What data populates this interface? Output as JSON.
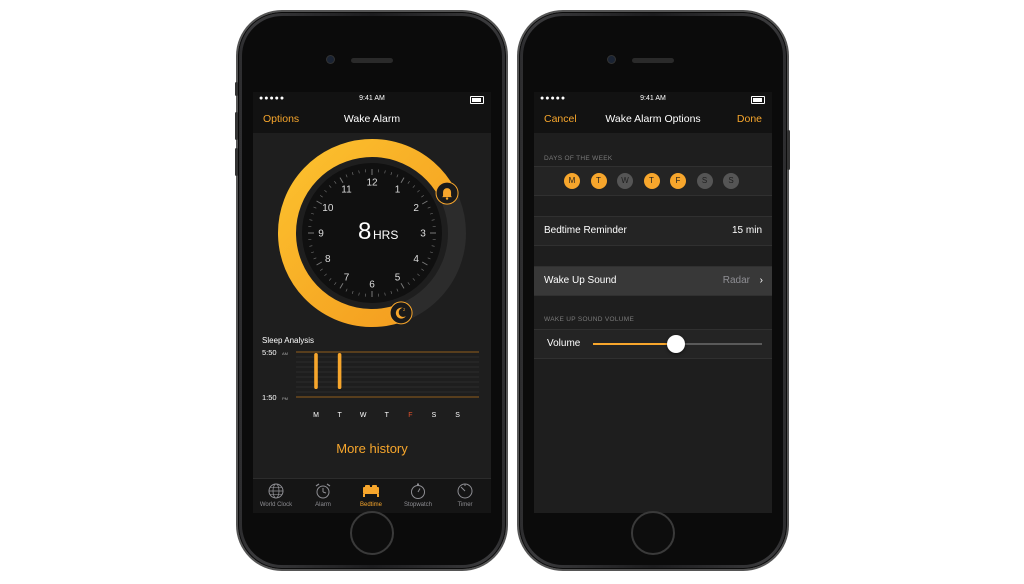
{
  "status": {
    "signal": "●●●●● ",
    "time": "9:41 AM"
  },
  "left_screen": {
    "nav": {
      "left": "Options",
      "title": "Wake Alarm"
    },
    "dial": {
      "hours_value": "8",
      "hours_unit": "HRS",
      "numbers": [
        "12",
        "1",
        "2",
        "3",
        "4",
        "5",
        "6",
        "7",
        "8",
        "9",
        "10",
        "11"
      ],
      "arc_color": "#f7a62c",
      "bedtime_icon": "moon-icon",
      "wake_icon": "bell-icon"
    },
    "sleep_title": "Sleep Analysis",
    "chart": {
      "top_time": "5:50",
      "top_ampm": "AM",
      "bottom_time": "1:50",
      "bottom_ampm": "PM",
      "days": [
        "M",
        "T",
        "W",
        "T",
        "F",
        "S",
        "S"
      ],
      "today_index": 4,
      "bars": [
        1,
        1,
        0,
        0,
        0,
        0,
        0
      ]
    },
    "more_history": "More history",
    "tabs": [
      {
        "label": "World Clock",
        "icon": "globe-icon"
      },
      {
        "label": "Alarm",
        "icon": "alarm-clock-icon"
      },
      {
        "label": "Bedtime",
        "icon": "bed-icon"
      },
      {
        "label": "Stopwatch",
        "icon": "stopwatch-icon"
      },
      {
        "label": "Timer",
        "icon": "timer-icon"
      }
    ],
    "active_tab": 2
  },
  "right_screen": {
    "nav": {
      "left": "Cancel",
      "title": "Wake Alarm Options",
      "right": "Done"
    },
    "days_label": "DAYS OF THE WEEK",
    "days": [
      {
        "label": "M",
        "on": true
      },
      {
        "label": "T",
        "on": true
      },
      {
        "label": "W",
        "on": false
      },
      {
        "label": "T",
        "on": true
      },
      {
        "label": "F",
        "on": true
      },
      {
        "label": "S",
        "on": false
      },
      {
        "label": "S",
        "on": false
      }
    ],
    "reminder": {
      "label": "Bedtime Reminder",
      "value": "15 min"
    },
    "sound": {
      "label": "Wake Up Sound",
      "value": "Radar"
    },
    "volume_label_section": "WAKE UP SOUND VOLUME",
    "volume": {
      "label": "Volume",
      "level": 0.49
    }
  }
}
